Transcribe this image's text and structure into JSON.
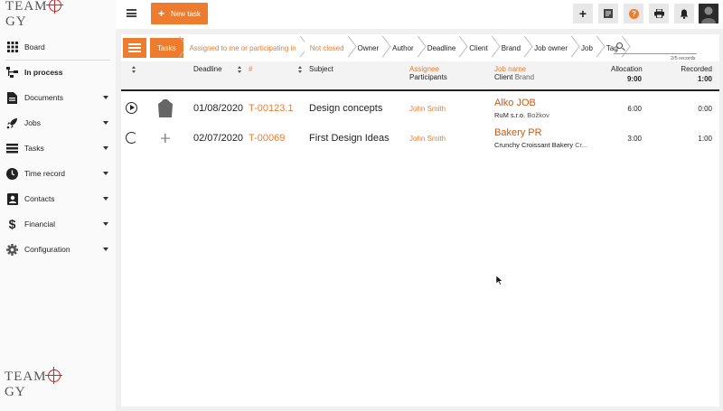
{
  "app": {
    "logo_text_a": "TEAM",
    "logo_text_b": "GY"
  },
  "sidebar": {
    "items": [
      {
        "label": "Board",
        "icon": "grid-icon",
        "has_caret": false
      },
      {
        "label": "In process",
        "icon": "flow-icon",
        "has_caret": false
      },
      {
        "label": "Documents",
        "icon": "document-icon",
        "has_caret": true
      },
      {
        "label": "Jobs",
        "icon": "rocket-icon",
        "has_caret": true
      },
      {
        "label": "Tasks",
        "icon": "tasks-icon",
        "has_caret": true
      },
      {
        "label": "Time record",
        "icon": "clock-icon",
        "has_caret": true
      },
      {
        "label": "Contacts",
        "icon": "contacts-icon",
        "has_caret": true
      },
      {
        "label": "Financial",
        "icon": "dollar-icon",
        "has_caret": true
      },
      {
        "label": "Configuration",
        "icon": "gear-icon",
        "has_caret": true
      }
    ]
  },
  "topbar": {
    "new_task_label": "New task",
    "buttons": [
      "plus-icon",
      "notes-icon",
      "help-icon",
      "print-icon",
      "bell-icon"
    ]
  },
  "filter": {
    "crumbs": [
      {
        "label": "Tasks",
        "style": "first"
      },
      {
        "label": "Assigned to me or participating in",
        "style": "orange"
      },
      {
        "label": "Not closed",
        "style": "orange"
      },
      {
        "label": "Owner",
        "style": "plain"
      },
      {
        "label": "Author",
        "style": "plain"
      },
      {
        "label": "Deadline",
        "style": "plain"
      },
      {
        "label": "Client",
        "style": "plain"
      },
      {
        "label": "Brand",
        "style": "plain"
      },
      {
        "label": "Job owner",
        "style": "plain"
      },
      {
        "label": "Job",
        "style": "plain"
      },
      {
        "label": "Tag",
        "style": "plain"
      }
    ],
    "search_placeholder": "",
    "records": "2/5 records"
  },
  "table": {
    "headers": {
      "deadline": "Deadline",
      "id": "#",
      "subject": "Subject",
      "assignee": "Assignee",
      "participants": "Participants",
      "job_name": "Job name",
      "client": "Client",
      "brand": "Brand",
      "allocation": "Allocation",
      "allocation_total": "9:00",
      "recorded": "Recorded",
      "recorded_total": "1:00"
    },
    "rows": [
      {
        "deadline": "01/08/2020",
        "id": "T-00123.1",
        "subject": "Design concepts",
        "assignee": "John Smith",
        "job_name": "Alko JOB",
        "client": "RuM s.r.o.",
        "brand": "Božkov",
        "allocation": "6:00",
        "recorded": "0:00",
        "state": "play"
      },
      {
        "deadline": "02/07/2020",
        "id": "T-00069",
        "subject": "First Design Ideas",
        "assignee": "John Smith",
        "job_name": "Bakery PR",
        "client": "Crunchy Croissant Bakery",
        "brand": "Cr...",
        "allocation": "3:00",
        "recorded": "1:00",
        "state": "running"
      }
    ]
  },
  "colors": {
    "accent": "#ee7c2e",
    "job": "#c85a12",
    "logo_mark": "#c62828"
  }
}
